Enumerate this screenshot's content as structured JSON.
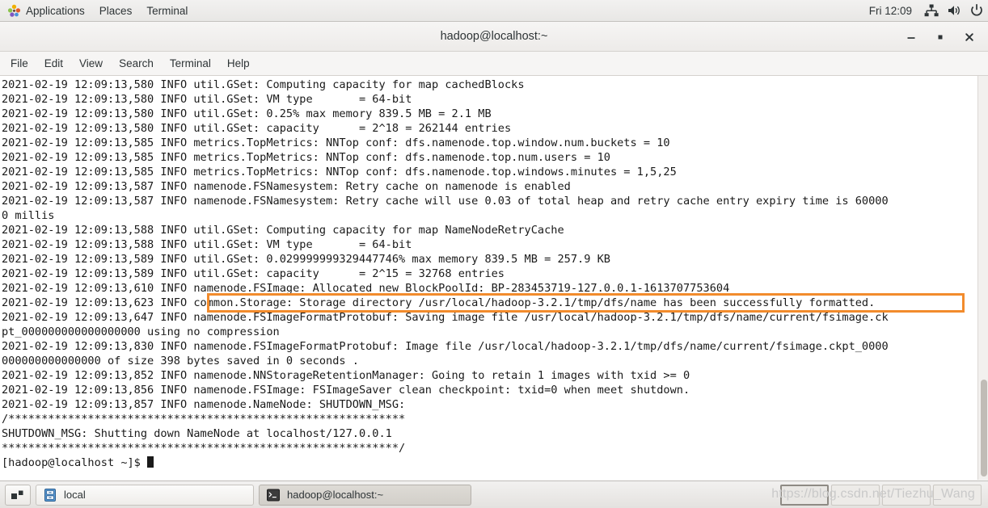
{
  "top_panel": {
    "apps_label": "Applications",
    "places_label": "Places",
    "terminal_label": "Terminal",
    "clock": "Fri 12:09",
    "icons": {
      "apps": "applications-icon",
      "network": "network-icon",
      "volume": "volume-icon",
      "power": "power-icon"
    }
  },
  "window": {
    "title": "hadoop@localhost:~",
    "buttons": {
      "minimize": "minimize-button",
      "maximize": "maximize-button",
      "close": "close-button"
    }
  },
  "menubar": {
    "items": [
      {
        "label": "File"
      },
      {
        "label": "Edit"
      },
      {
        "label": "View"
      },
      {
        "label": "Search"
      },
      {
        "label": "Terminal"
      },
      {
        "label": "Help"
      }
    ]
  },
  "terminal": {
    "lines": [
      "2021-02-19 12:09:13,580 INFO util.GSet: Computing capacity for map cachedBlocks",
      "2021-02-19 12:09:13,580 INFO util.GSet: VM type       = 64-bit",
      "2021-02-19 12:09:13,580 INFO util.GSet: 0.25% max memory 839.5 MB = 2.1 MB",
      "2021-02-19 12:09:13,580 INFO util.GSet: capacity      = 2^18 = 262144 entries",
      "2021-02-19 12:09:13,585 INFO metrics.TopMetrics: NNTop conf: dfs.namenode.top.window.num.buckets = 10",
      "2021-02-19 12:09:13,585 INFO metrics.TopMetrics: NNTop conf: dfs.namenode.top.num.users = 10",
      "2021-02-19 12:09:13,585 INFO metrics.TopMetrics: NNTop conf: dfs.namenode.top.windows.minutes = 1,5,25",
      "2021-02-19 12:09:13,587 INFO namenode.FSNamesystem: Retry cache on namenode is enabled",
      "2021-02-19 12:09:13,587 INFO namenode.FSNamesystem: Retry cache will use 0.03 of total heap and retry cache entry expiry time is 60000",
      "0 millis",
      "2021-02-19 12:09:13,588 INFO util.GSet: Computing capacity for map NameNodeRetryCache",
      "2021-02-19 12:09:13,588 INFO util.GSet: VM type       = 64-bit",
      "2021-02-19 12:09:13,589 INFO util.GSet: 0.029999999329447746% max memory 839.5 MB = 257.9 KB",
      "2021-02-19 12:09:13,589 INFO util.GSet: capacity      = 2^15 = 32768 entries",
      "2021-02-19 12:09:13,610 INFO namenode.FSImage: Allocated new BlockPoolId: BP-283453719-127.0.0.1-1613707753604",
      "2021-02-19 12:09:13,623 INFO common.Storage: Storage directory /usr/local/hadoop-3.2.1/tmp/dfs/name has been successfully formatted.",
      "2021-02-19 12:09:13,647 INFO namenode.FSImageFormatProtobuf: Saving image file /usr/local/hadoop-3.2.1/tmp/dfs/name/current/fsimage.ck",
      "pt_000000000000000000 using no compression",
      "2021-02-19 12:09:13,830 INFO namenode.FSImageFormatProtobuf: Image file /usr/local/hadoop-3.2.1/tmp/dfs/name/current/fsimage.ckpt_0000",
      "000000000000000 of size 398 bytes saved in 0 seconds .",
      "2021-02-19 12:09:13,852 INFO namenode.NNStorageRetentionManager: Going to retain 1 images with txid >= 0",
      "2021-02-19 12:09:13,856 INFO namenode.FSImage: FSImageSaver clean checkpoint: txid=0 when meet shutdown.",
      "2021-02-19 12:09:13,857 INFO namenode.NameNode: SHUTDOWN_MSG:",
      "/************************************************************",
      "SHUTDOWN_MSG: Shutting down NameNode at localhost/127.0.0.1",
      "************************************************************/",
      "[hadoop@localhost ~]$ "
    ],
    "highlight_color": "#f28b2c",
    "highlighted_line_index": 15
  },
  "taskbar": {
    "workspace_switcher": "workspace-switcher",
    "tasks": [
      {
        "label": "local",
        "icon": "file-manager-icon",
        "active": false
      },
      {
        "label": "hadoop@localhost:~",
        "icon": "terminal-icon",
        "active": true
      }
    ],
    "watermark": "https://blog.csdn.net/Tiezhu_Wang"
  }
}
